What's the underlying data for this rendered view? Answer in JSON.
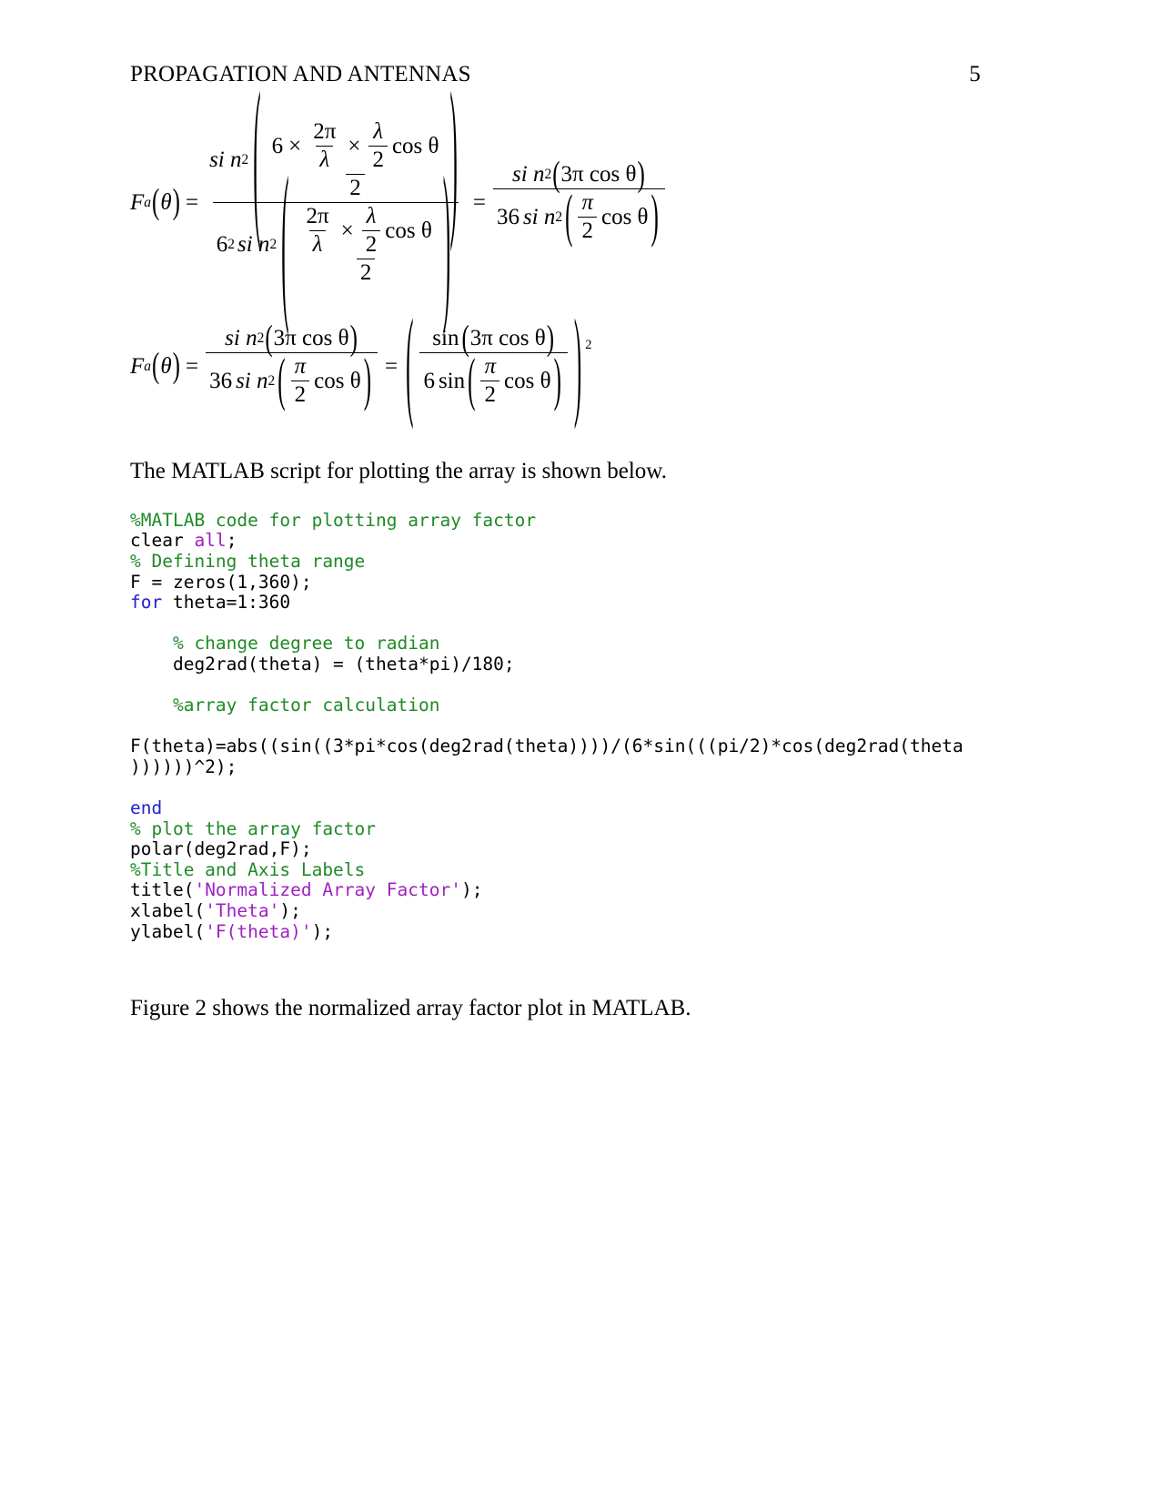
{
  "header": {
    "title": "PROPAGATION AND ANTENNAS",
    "page_number": "5"
  },
  "equations": {
    "eq1": {
      "lhs_function": "F",
      "lhs_subscript": "a",
      "lhs_arg": "θ",
      "numerator_factor": "6",
      "times": "×",
      "two_pi": "2π",
      "lambda": "λ",
      "half_lambda_num": "λ",
      "half_lambda_den": "2",
      "cos_theta": "cos θ",
      "inner_den": "2",
      "six_squared_base": "6",
      "six_squared_exp": "2",
      "sin_text": "si n",
      "sin_exp": "2",
      "rhs_num": "si n²(3π cos θ)",
      "rhs_den_coeff": "36",
      "rhs_pi": "π",
      "rhs_two": "2",
      "three_pi": "3π",
      "equals": "="
    },
    "eq2": {
      "lhs_function": "F",
      "lhs_subscript": "a",
      "lhs_arg": "θ",
      "num_sin": "si n",
      "num_exp": "2",
      "num_arg": "3π cos θ",
      "den_coeff": "36",
      "den_sin": "si n",
      "den_exp": "2",
      "den_pi": "π",
      "den_two": "2",
      "den_cos": "cos θ",
      "right_num_sin": "sin",
      "right_num_arg": "3π cos θ",
      "right_den_coeff": "6",
      "right_den_sin": "sin",
      "right_den_pi": "π",
      "right_den_two": "2",
      "right_den_cos": "cos θ",
      "outer_exp": "2",
      "equals": "="
    }
  },
  "paragraphs": {
    "intro": "The MATLAB script for plotting the array is shown below.",
    "closing": "Figure 2 shows the normalized array factor plot in MATLAB."
  },
  "code": {
    "language": "MATLAB",
    "colors": {
      "comment": "#1f8a26",
      "keyword": "#2222cc",
      "string": "#a020c0",
      "plain": "#000000"
    },
    "lines": [
      [
        {
          "t": "%MATLAB code for plotting array factor",
          "c": "comment"
        }
      ],
      [
        {
          "t": "clear ",
          "c": "plain"
        },
        {
          "t": "all",
          "c": "string"
        },
        {
          "t": ";",
          "c": "plain"
        }
      ],
      [
        {
          "t": "% Defining theta range",
          "c": "comment"
        }
      ],
      [
        {
          "t": "F = zeros(1,360);",
          "c": "plain"
        }
      ],
      [
        {
          "t": "for",
          "c": "keyword"
        },
        {
          "t": " theta=1:360",
          "c": "plain"
        }
      ],
      [
        {
          "t": "",
          "c": "plain"
        }
      ],
      [
        {
          "t": "    % change degree to radian",
          "c": "comment"
        }
      ],
      [
        {
          "t": "    deg2rad(theta) = (theta*pi)/180;",
          "c": "plain"
        }
      ],
      [
        {
          "t": "",
          "c": "plain"
        }
      ],
      [
        {
          "t": "    %array factor calculation",
          "c": "comment"
        }
      ],
      [
        {
          "t": "",
          "c": "plain"
        }
      ],
      [
        {
          "t": "F(theta)=abs((sin((3*pi*cos(deg2rad(theta))))/(6*sin(((pi/2)*cos(deg2rad(theta",
          "c": "plain"
        }
      ],
      [
        {
          "t": "))))))^2);",
          "c": "plain"
        }
      ],
      [
        {
          "t": "",
          "c": "plain"
        }
      ],
      [
        {
          "t": "end",
          "c": "keyword"
        }
      ],
      [
        {
          "t": "% plot the array factor",
          "c": "comment"
        }
      ],
      [
        {
          "t": "polar(deg2rad,F);",
          "c": "plain"
        }
      ],
      [
        {
          "t": "%Title and Axis Labels",
          "c": "comment"
        }
      ],
      [
        {
          "t": "title(",
          "c": "plain"
        },
        {
          "t": "'Normalized Array Factor'",
          "c": "string"
        },
        {
          "t": ");",
          "c": "plain"
        }
      ],
      [
        {
          "t": "xlabel(",
          "c": "plain"
        },
        {
          "t": "'Theta'",
          "c": "string"
        },
        {
          "t": ");",
          "c": "plain"
        }
      ],
      [
        {
          "t": "ylabel(",
          "c": "plain"
        },
        {
          "t": "'F(theta)'",
          "c": "string"
        },
        {
          "t": ");",
          "c": "plain"
        }
      ]
    ]
  }
}
